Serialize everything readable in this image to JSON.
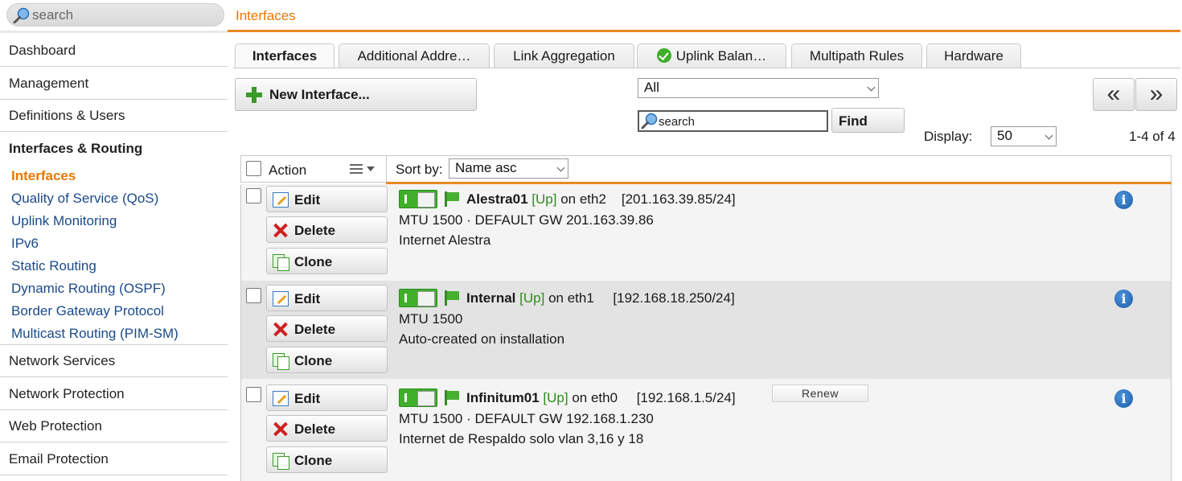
{
  "search": {
    "placeholder": "search"
  },
  "sidebar": {
    "items": [
      {
        "label": "Dashboard"
      },
      {
        "label": "Management"
      },
      {
        "label": "Definitions & Users"
      },
      {
        "label": "Interfaces & Routing"
      },
      {
        "label": "Network Services"
      },
      {
        "label": "Network Protection"
      },
      {
        "label": "Web Protection"
      },
      {
        "label": "Email Protection"
      }
    ],
    "subitems": [
      {
        "label": "Interfaces",
        "active": true
      },
      {
        "label": "Quality of Service (QoS)"
      },
      {
        "label": "Uplink Monitoring"
      },
      {
        "label": "IPv6"
      },
      {
        "label": "Static Routing"
      },
      {
        "label": "Dynamic Routing (OSPF)"
      },
      {
        "label": "Border Gateway Protocol"
      },
      {
        "label": "Multicast Routing (PIM-SM)"
      }
    ]
  },
  "header": {
    "title": "Interfaces"
  },
  "tabs": [
    {
      "label": "Interfaces",
      "active": true
    },
    {
      "label": "Additional Addre…"
    },
    {
      "label": "Link Aggregation"
    },
    {
      "label": "Uplink Balan…",
      "icon": "check-icon"
    },
    {
      "label": "Multipath Rules"
    },
    {
      "label": "Hardware"
    }
  ],
  "toolbar": {
    "new_label": "New Interface...",
    "filter_value": "All",
    "search_value": "search",
    "find_label": "Find",
    "first_glyph": "«",
    "next_glyph": "»",
    "display_label": "Display:",
    "display_value": "50",
    "count_text": "1-4 of 4"
  },
  "list": {
    "action_label": "Action",
    "sort_label": "Sort by:",
    "sort_value": "Name asc",
    "edit_label": "Edit",
    "delete_label": "Delete",
    "clone_label": "Clone",
    "renew_label": "Renew",
    "rows": [
      {
        "name": "Alestra01",
        "status": "[Up]",
        "on": "on eth2",
        "address": "[201.163.39.85/24]",
        "detail": "MTU 1500 · DEFAULT GW 201.163.39.86",
        "comment": "Internet Alestra"
      },
      {
        "name": "Internal",
        "status": "[Up]",
        "on": "on eth1",
        "address": "[192.168.18.250/24]",
        "detail": "MTU 1500",
        "comment": "Auto-created on installation"
      },
      {
        "name": "Infinitum01",
        "status": "[Up]",
        "on": "on eth0",
        "address": "[192.168.1.5/24]",
        "detail": "MTU 1500 · DEFAULT GW 192.168.1.230",
        "comment": "Internet de Respaldo solo vlan 3,16 y 18"
      }
    ]
  },
  "colors": {
    "accent": "#e87800",
    "link": "#1a4a8a",
    "status_up": "#2e8a1e",
    "rule": "#e88a20"
  }
}
